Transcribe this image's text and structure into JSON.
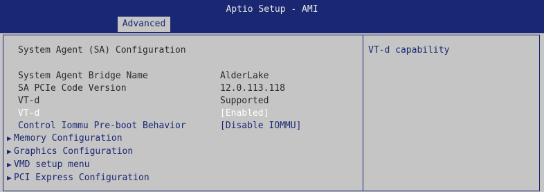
{
  "header": {
    "title": "Aptio Setup - AMI",
    "tab": "Advanced"
  },
  "section_title": "System Agent (SA) Configuration",
  "settings": [
    {
      "label": "System Agent Bridge Name",
      "value": "AlderLake"
    },
    {
      "label": "SA PCIe Code Version",
      "value": "12.0.113.118"
    },
    {
      "label": "VT-d",
      "value": "Supported"
    },
    {
      "label": "VT-d",
      "value": "[Enabled]"
    },
    {
      "label": "Control Iommu Pre-boot Behavior",
      "value": "[Disable IOMMU]"
    }
  ],
  "submenus": [
    {
      "label": "Memory Configuration"
    },
    {
      "label": "Graphics Configuration"
    },
    {
      "label": "VMD setup menu"
    },
    {
      "label": "PCI Express Configuration"
    }
  ],
  "help_text": "VT-d capability",
  "colors": {
    "header_bg": "#1a2873",
    "panel_bg": "#c5c5c5",
    "highlight": "#ffffff",
    "link": "#1a2873"
  },
  "icons": {
    "submenu_arrow": "right-triangle-icon"
  }
}
